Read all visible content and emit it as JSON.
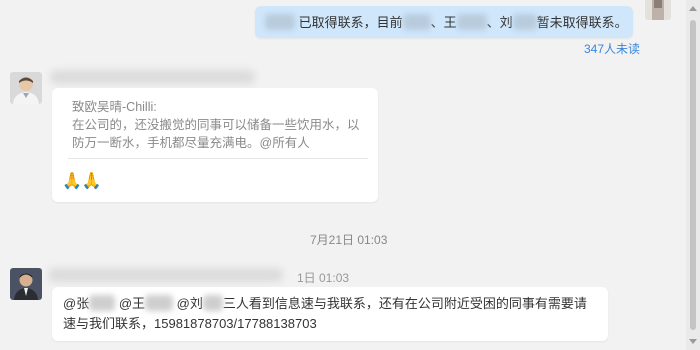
{
  "messages": {
    "self_message": {
      "part1": "已取得联系，目前",
      "part2": "、王",
      "part3": "、刘",
      "part4": "暂未取得联系。",
      "unread": "347人未读"
    },
    "quoted_message": {
      "quote_author": "致欧吴晴-Chilli:",
      "quote_text": "在公司的，还没搬觉的同事可以储备一些饮用水，以防万一断水，手机都尽量充满电。@所有人",
      "reply": "🙏🙏"
    },
    "separator_time": "7月21日 01:03",
    "second_time": "1日 01:03",
    "last_message": {
      "mention1": "@张",
      "mention2": "@王",
      "mention3": "@刘",
      "text": "三人看到信息速与我联系，还有在公司附近受困的同事有需要请速与我们联系，15981878703/17788138703"
    }
  }
}
